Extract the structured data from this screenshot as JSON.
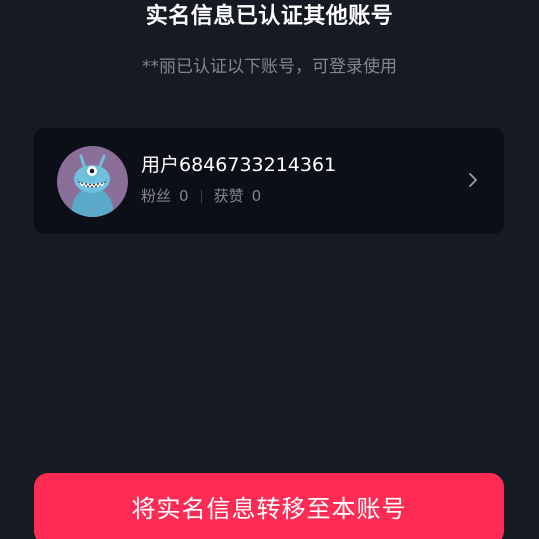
{
  "header": {
    "title": "实名信息已认证其他账号",
    "subtitle": "**丽已认证以下账号，可登录使用"
  },
  "account": {
    "username": "用户6846733214361",
    "followers_label": "粉丝",
    "followers_count": "0",
    "likes_label": "获赞",
    "likes_count": "0",
    "avatar_color": "#8a6f99"
  },
  "action": {
    "transfer_label": "将实名信息转移至本账号",
    "color": "#fe2c55"
  },
  "icons": {
    "avatar": "monster-avatar-icon",
    "chevron": "chevron-right-icon"
  }
}
